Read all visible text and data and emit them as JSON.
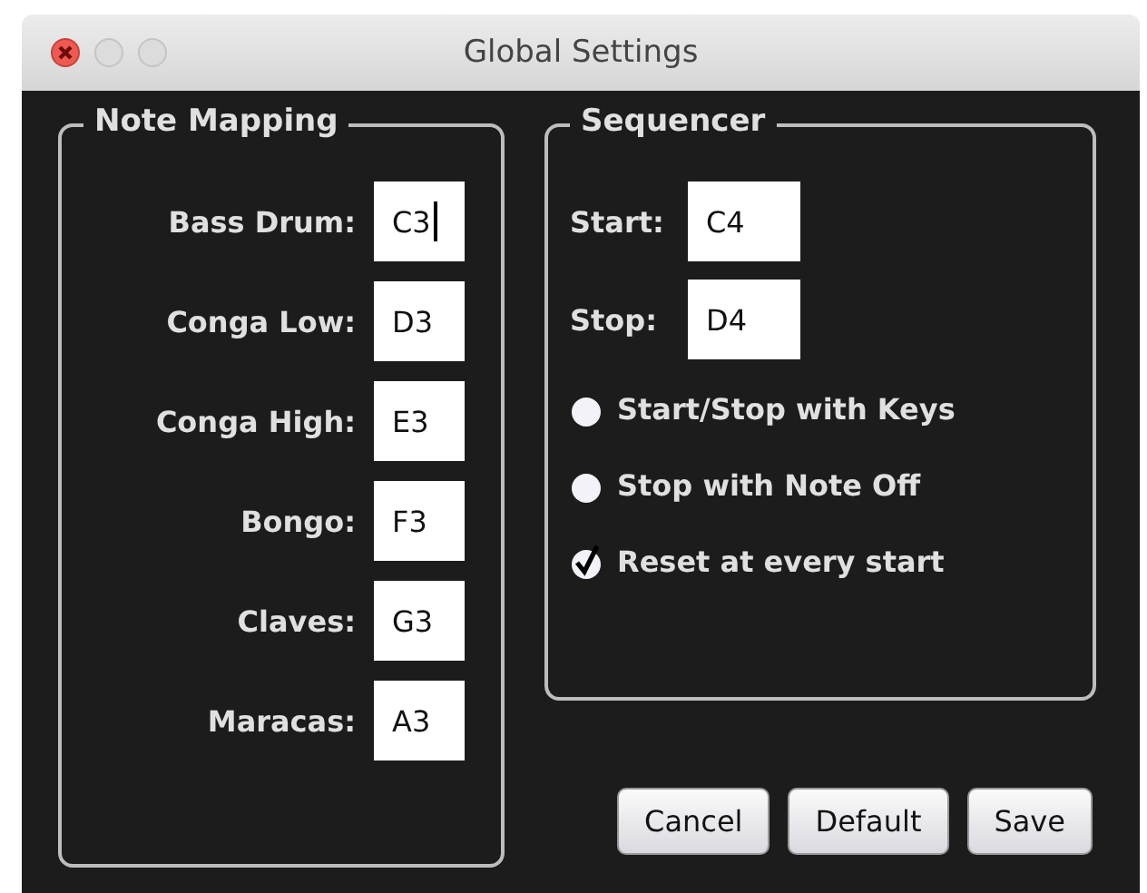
{
  "window": {
    "title": "Global Settings"
  },
  "note_mapping": {
    "title": "Note Mapping",
    "rows": [
      {
        "label": "Bass Drum:",
        "value": "C3",
        "focused": true
      },
      {
        "label": "Conga Low:",
        "value": "D3",
        "focused": false
      },
      {
        "label": "Conga High:",
        "value": "E3",
        "focused": false
      },
      {
        "label": "Bongo:",
        "value": "F3",
        "focused": false
      },
      {
        "label": "Claves:",
        "value": "G3",
        "focused": false
      },
      {
        "label": "Maracas:",
        "value": "A3",
        "focused": false
      }
    ]
  },
  "sequencer": {
    "title": "Sequencer",
    "fields": [
      {
        "label": "Start:",
        "value": "C4"
      },
      {
        "label": "Stop:",
        "value": "D4"
      }
    ],
    "options": [
      {
        "label": "Start/Stop with Keys",
        "checked": false
      },
      {
        "label": "Stop with Note Off",
        "checked": false
      },
      {
        "label": "Reset at every start",
        "checked": true
      }
    ]
  },
  "buttons": [
    "Cancel",
    "Default",
    "Save"
  ]
}
